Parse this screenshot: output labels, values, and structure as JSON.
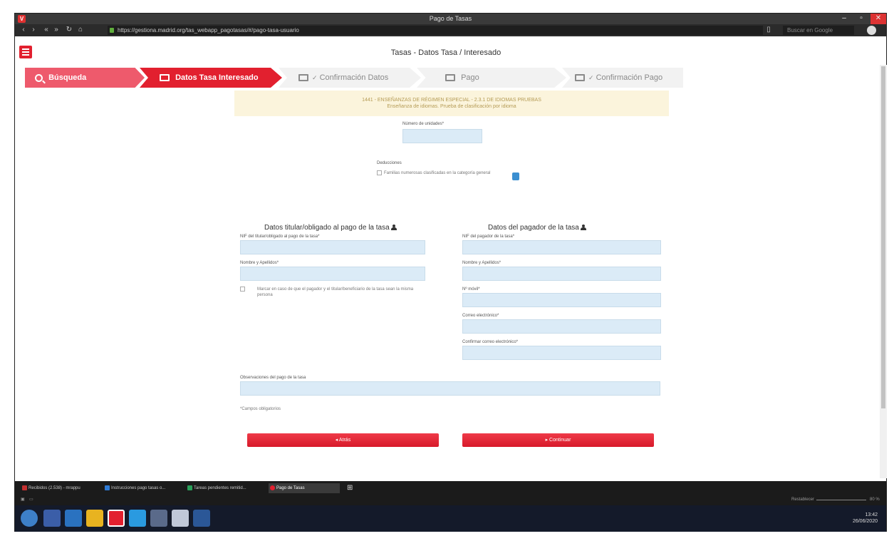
{
  "browser": {
    "window_title": "Pago de Tasas",
    "url": "https://gestiona.madrid.org/tas_webapp_pagotasas/#/pago-tasa-usuario",
    "search_placeholder": "Buscar en Google"
  },
  "app": {
    "title": "Tasas - Datos Tasa / Interesado"
  },
  "steps": [
    {
      "label": "Búsqueda",
      "state": "done"
    },
    {
      "label": "Datos Tasa Interesado",
      "state": "active"
    },
    {
      "label": "Confirmación Datos",
      "state": "pending"
    },
    {
      "label": "Pago",
      "state": "pending"
    },
    {
      "label": "Confirmación Pago",
      "state": "pending"
    }
  ],
  "notice": {
    "line1": "1441 - ENSEÑANZAS DE RÉGIMEN ESPECIAL - 2.3.1 DE IDIOMAS PRUEBAS",
    "line2": "Enseñanza de idiomas. Prueba de clasificación por idioma"
  },
  "form": {
    "units_label": "Número de unidades*",
    "units_value": "",
    "deductions_label": "Deducciones",
    "deduction_option": "Familias numerosas clasificadas en la categoría general",
    "left_section_title": "Datos titular/obligado al pago de la tasa",
    "left_nif_label": "NIF del titular/obligado al pago de la tasa*",
    "left_name_label": "Nombre y Apellidos*",
    "same_person_text": "Marcar en caso de que el pagador y el titular/beneficiario de la tasa sean la misma persona",
    "right_section_title": "Datos del pagador de la tasa",
    "right_nif_label": "NIF del pagador de la tasa*",
    "right_name_label": "Nombre y Apellidos*",
    "phone_label": "Nº móvil*",
    "email_label": "Correo electrónico*",
    "email_confirm_label": "Confirmar correo electrónico*",
    "observations_label": "Observaciones del pago de la tasa",
    "required_note": "*Campos obligatorios",
    "back_button": "◂ Atrás",
    "continue_button": "▸ Continuar"
  },
  "tabs": [
    {
      "label": "Recibidos (2.538) - mrappu",
      "color": "#c23030"
    },
    {
      "label": "Instrucciones pago tasas o...",
      "color": "#2e7bd6"
    },
    {
      "label": "Tareas pendientes remitid...",
      "color": "#2aa05a"
    },
    {
      "label": "Pago de Tasas",
      "color": "#e2202f",
      "active": true
    }
  ],
  "status": {
    "zoom_label": "Restablecer",
    "zoom_value": "80 %"
  },
  "taskbar": {
    "time": "13:42",
    "date": "26/06/2020"
  }
}
